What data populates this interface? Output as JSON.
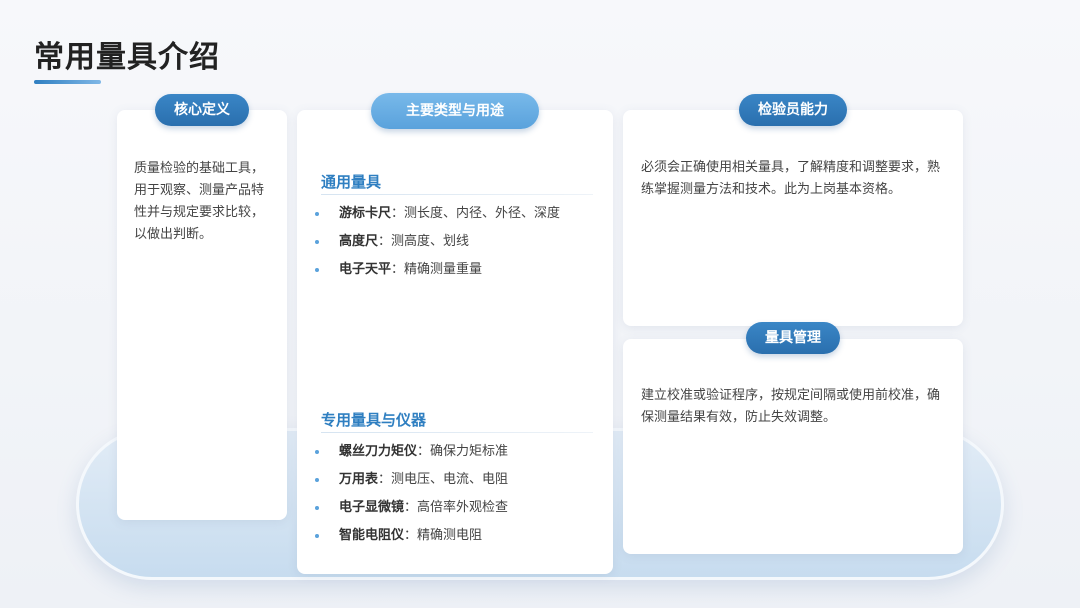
{
  "page": {
    "title": "常用量具介绍"
  },
  "core_definition": {
    "label": "核心定义",
    "text": "质量检验的基础工具，用于观察、测量产品特性并与规定要求比较，以做出判断。"
  },
  "main_types": {
    "label": "主要类型与用途",
    "general": {
      "heading": "通用量具",
      "items": [
        {
          "name": "游标卡尺",
          "sep": "：",
          "desc": "测长度、内径、外径、深度"
        },
        {
          "name": "高度尺",
          "sep": "：",
          "desc": "测高度、划线"
        },
        {
          "name": "电子天平",
          "sep": "：",
          "desc": "精确测量重量"
        }
      ]
    },
    "special": {
      "heading": "专用量具与仪器",
      "items": [
        {
          "name": "螺丝刀力矩仪",
          "sep": "：",
          "desc": "确保力矩标准"
        },
        {
          "name": "万用表",
          "sep": "：",
          "desc": "测电压、电流、电阻"
        },
        {
          "name": "电子显微镜",
          "sep": "：",
          "desc": "高倍率外观检查"
        },
        {
          "name": "智能电阻仪",
          "sep": "：",
          "desc": "精确测电阻"
        }
      ]
    }
  },
  "inspector_ability": {
    "label": "检验员能力",
    "text": "必须会正确使用相关量具，了解精度和调整要求，熟练掌握测量方法和技术。此为上岗基本资格。"
  },
  "gauge_management": {
    "label": "量具管理",
    "text": "建立校准或验证程序，按规定间隔或使用前校准，确保测量结果有效，防止失效调整。"
  },
  "colors": {
    "accent": "#2f7fc1",
    "accent_light": "#5aa2dc",
    "pill_dark": "#2a6fae",
    "platform": "#cfe1f1"
  }
}
